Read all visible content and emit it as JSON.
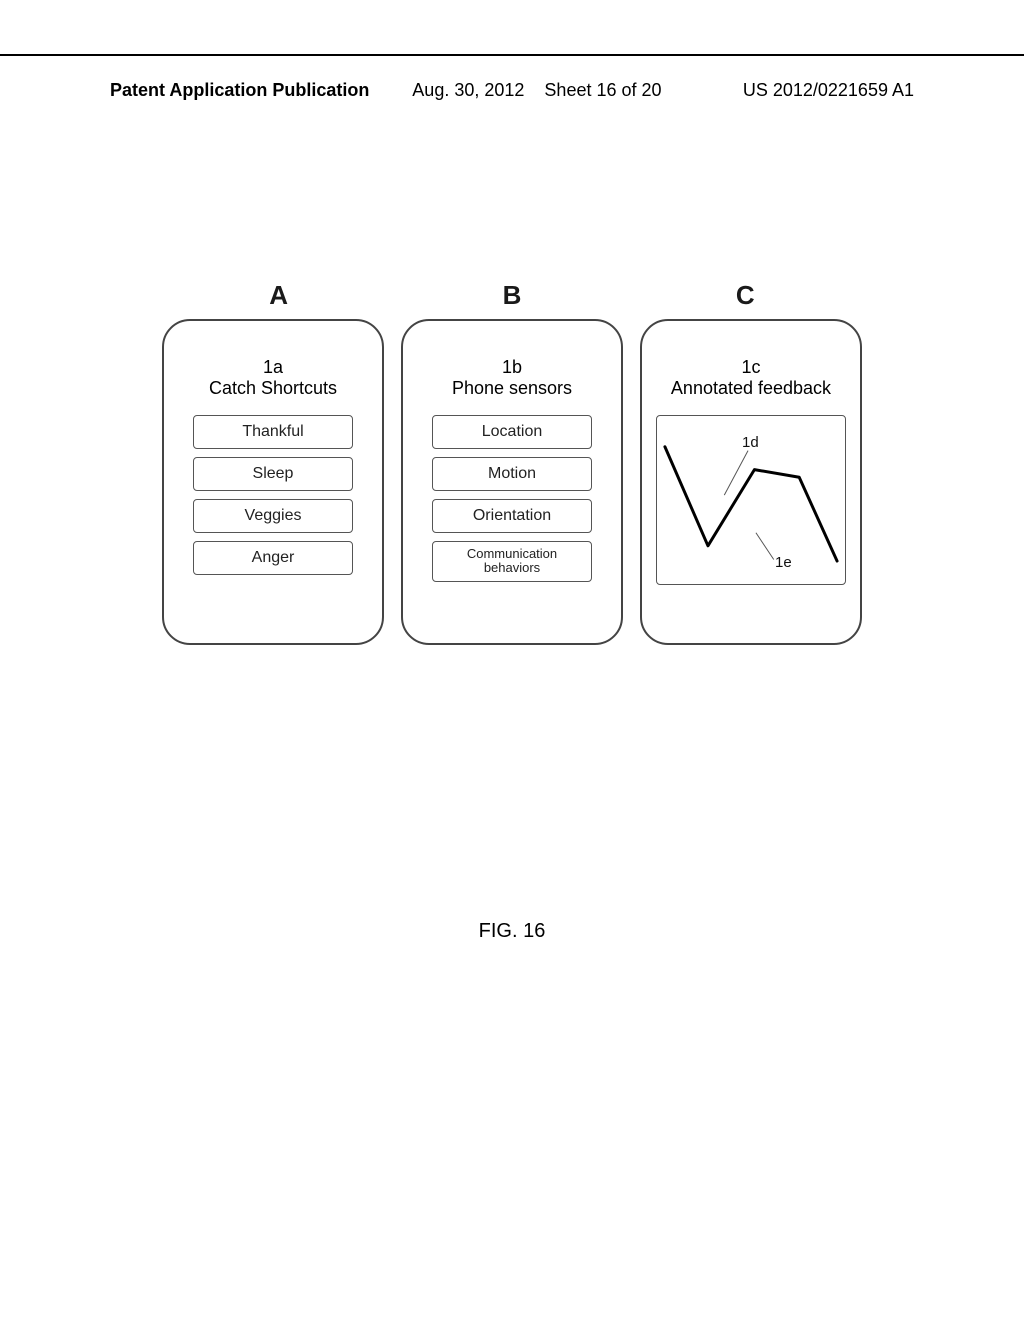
{
  "header": {
    "left": "Patent Application Publication",
    "mid_date": "Aug. 30, 2012",
    "mid_sheet": "Sheet 16 of 20",
    "right": "US 2012/0221659 A1"
  },
  "figure": {
    "caption": "FIG. 16",
    "top_labels": [
      "A",
      "B",
      "C"
    ],
    "panel_a": {
      "code": "1a",
      "title": "Catch Shortcuts",
      "items": [
        "Thankful",
        "Sleep",
        "Veggies",
        "Anger"
      ]
    },
    "panel_b": {
      "code": "1b",
      "title": "Phone sensors",
      "items": [
        "Location",
        "Motion",
        "Orientation",
        "Communication behaviors"
      ]
    },
    "panel_c": {
      "code": "1c",
      "title": "Annotated feedback",
      "annot_1d": "1d",
      "annot_1e": "1e"
    }
  },
  "chart_data": {
    "type": "line",
    "x": [
      0,
      25,
      52,
      78,
      100
    ],
    "values": [
      85,
      20,
      70,
      65,
      10
    ],
    "title": "",
    "xlabel": "",
    "ylabel": "",
    "ylim": [
      0,
      100
    ]
  }
}
